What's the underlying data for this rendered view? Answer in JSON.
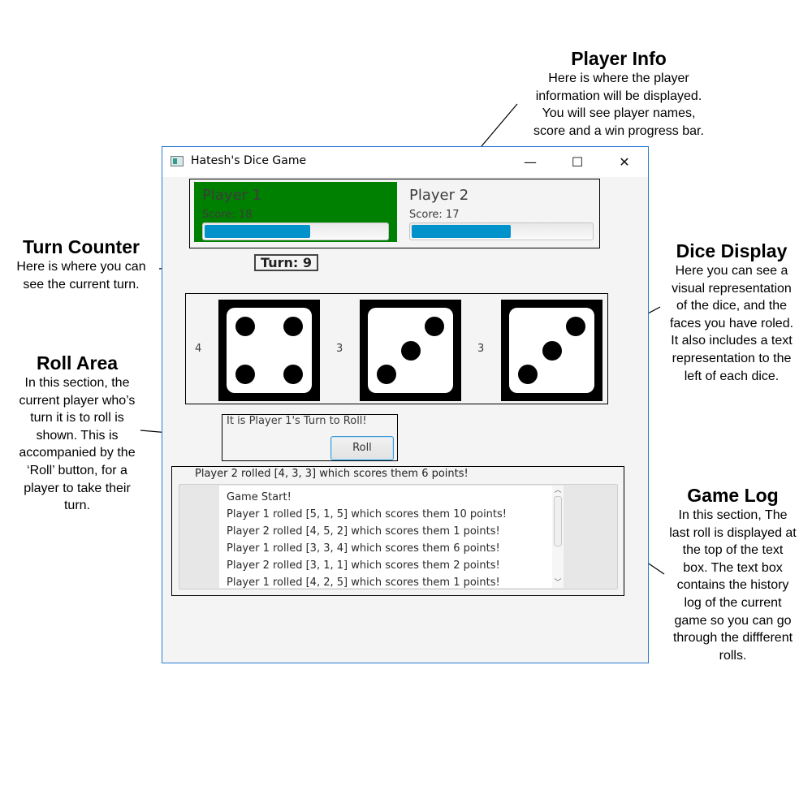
{
  "annotations": {
    "player_info": {
      "title": "Player Info",
      "lines": [
        "Here is where the player",
        "information will be displayed.",
        "You will see player names,",
        "score and a win progress bar."
      ]
    },
    "turn_counter": {
      "title": "Turn Counter",
      "lines": [
        "Here is where you can",
        "see the current turn."
      ]
    },
    "dice_display": {
      "title": "Dice Display",
      "lines": [
        "Here you can see a",
        "visual representation",
        "of the dice, and the",
        "faces you have roled.",
        "It also includes a text",
        "representation to the",
        "left of each dice."
      ]
    },
    "roll_area": {
      "title": "Roll Area",
      "lines": [
        "In this section, the",
        "current player who’s",
        "turn it is to roll is",
        "shown. This is",
        "accompanied by the",
        "‘Roll’ button, for a",
        "player to take their",
        "turn."
      ]
    },
    "game_log": {
      "title": "Game Log",
      "lines": [
        "In this section, The",
        "last roll is displayed at",
        "the top of the text",
        "box. The text box",
        "contains the history",
        "log of the current",
        "game so you can go",
        "through the diffferent",
        "rolls."
      ]
    }
  },
  "window": {
    "title": "Hatesh's Dice Game",
    "minimize": "—",
    "maximize": "☐",
    "close": "✕"
  },
  "players": [
    {
      "name": "Player 1",
      "score_text": "Score: 18",
      "progress": 0.58,
      "active": true
    },
    {
      "name": "Player 2",
      "score_text": "Score: 17",
      "progress": 0.55,
      "active": false
    }
  ],
  "turn": {
    "text": "Turn: 9"
  },
  "dice": [
    {
      "label": "4",
      "value": 4
    },
    {
      "label": "3",
      "value": 3
    },
    {
      "label": "3",
      "value": 3
    }
  ],
  "roll": {
    "status": "It is Player 1's Turn to Roll!",
    "button_label": "Roll"
  },
  "log": {
    "last_roll": "Player 2 rolled [4, 3, 3] which scores them 6 points!",
    "lines": [
      "Game Start!",
      "Player 1 rolled [5, 1, 5] which scores them 10 points!",
      "Player 2 rolled [4, 5, 2] which scores them 1 points!",
      "Player 1 rolled [3, 3, 4] which scores them 6 points!",
      "Player 2 rolled [3, 1, 1] which scores them 2 points!",
      "Player 1 rolled [4, 2, 5] which scores them 1 points!"
    ]
  },
  "colors": {
    "active_player_bg": "#008000",
    "progress_fill": "#0093cb",
    "window_border": "#2b79d1"
  }
}
